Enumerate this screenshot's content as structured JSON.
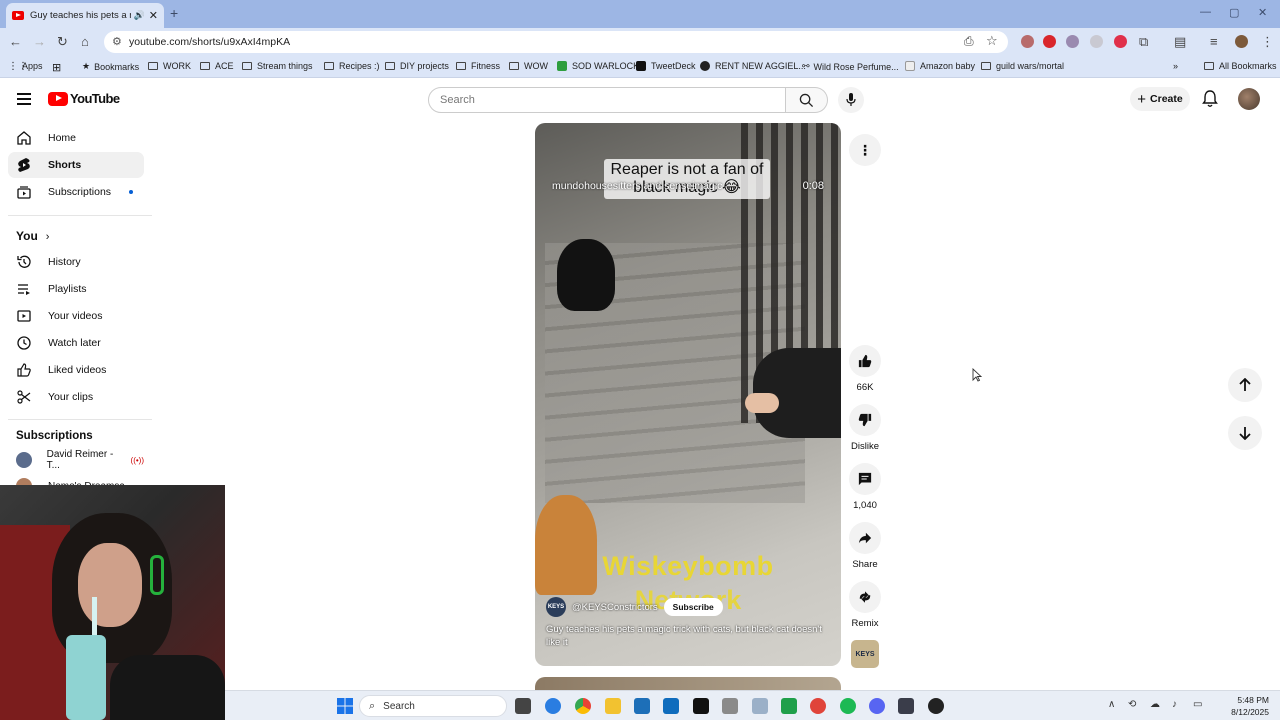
{
  "browser": {
    "tab_title": "Guy teaches his pets a mag",
    "tab_close": "✕",
    "new_tab": "+",
    "url": "youtube.com/shorts/u9xAxI4mpKA",
    "bookmarks": [
      {
        "label": "Apps"
      },
      {
        "label": "Bookmarks"
      },
      {
        "label": "WORK"
      },
      {
        "label": "ACE"
      },
      {
        "label": "Stream things"
      },
      {
        "label": "Recipes :)"
      },
      {
        "label": "DIY projects"
      },
      {
        "label": "Fitness"
      },
      {
        "label": "WOW"
      },
      {
        "label": "SOD WARLOCK"
      },
      {
        "label": "TweetDeck"
      },
      {
        "label": "RENT NEW AGGIEL..."
      },
      {
        "label": "Wild Rose Perfume..."
      },
      {
        "label": "Amazon baby"
      },
      {
        "label": "guild wars/mortal"
      }
    ],
    "all_bookmarks": "All Bookmarks",
    "accent": "#9db6e4"
  },
  "youtube": {
    "logo_text": "YouTube",
    "search_placeholder": "Search",
    "create_label": "Create",
    "sidebar": {
      "main": [
        {
          "label": "Home"
        },
        {
          "label": "Shorts"
        },
        {
          "label": "Subscriptions"
        }
      ],
      "you_header": "You",
      "you": [
        {
          "label": "History"
        },
        {
          "label": "Playlists"
        },
        {
          "label": "Your videos"
        },
        {
          "label": "Watch later"
        },
        {
          "label": "Liked videos"
        },
        {
          "label": "Your clips"
        }
      ],
      "subs_header": "Subscriptions",
      "subs": [
        {
          "label": "David Reimer - T..."
        },
        {
          "label": "Nemo's Dreamsc..."
        }
      ]
    },
    "short": {
      "caption": "Reaper is not a fan of black magic 😂",
      "overlay_channel": "mundohousesitters and senseimagic",
      "time": "0:08",
      "watermark_line1": "Wiskeybomb",
      "watermark_line2": "Network",
      "channel_avatar_text": "KEYS",
      "channel_handle": "@KEYSConstrictors",
      "subscribe_label": "Subscribe",
      "description": "Guy teaches his pets a magic trick with cats, but black cat doesn't like it"
    },
    "actions": {
      "likes": "66K",
      "dislike": "Dislike",
      "comments": "1,040",
      "share": "Share",
      "remix": "Remix",
      "keys_thumb": "KEYS"
    }
  },
  "taskbar": {
    "search": "Search",
    "time": "5:48 PM",
    "date": "8/12/2025"
  }
}
